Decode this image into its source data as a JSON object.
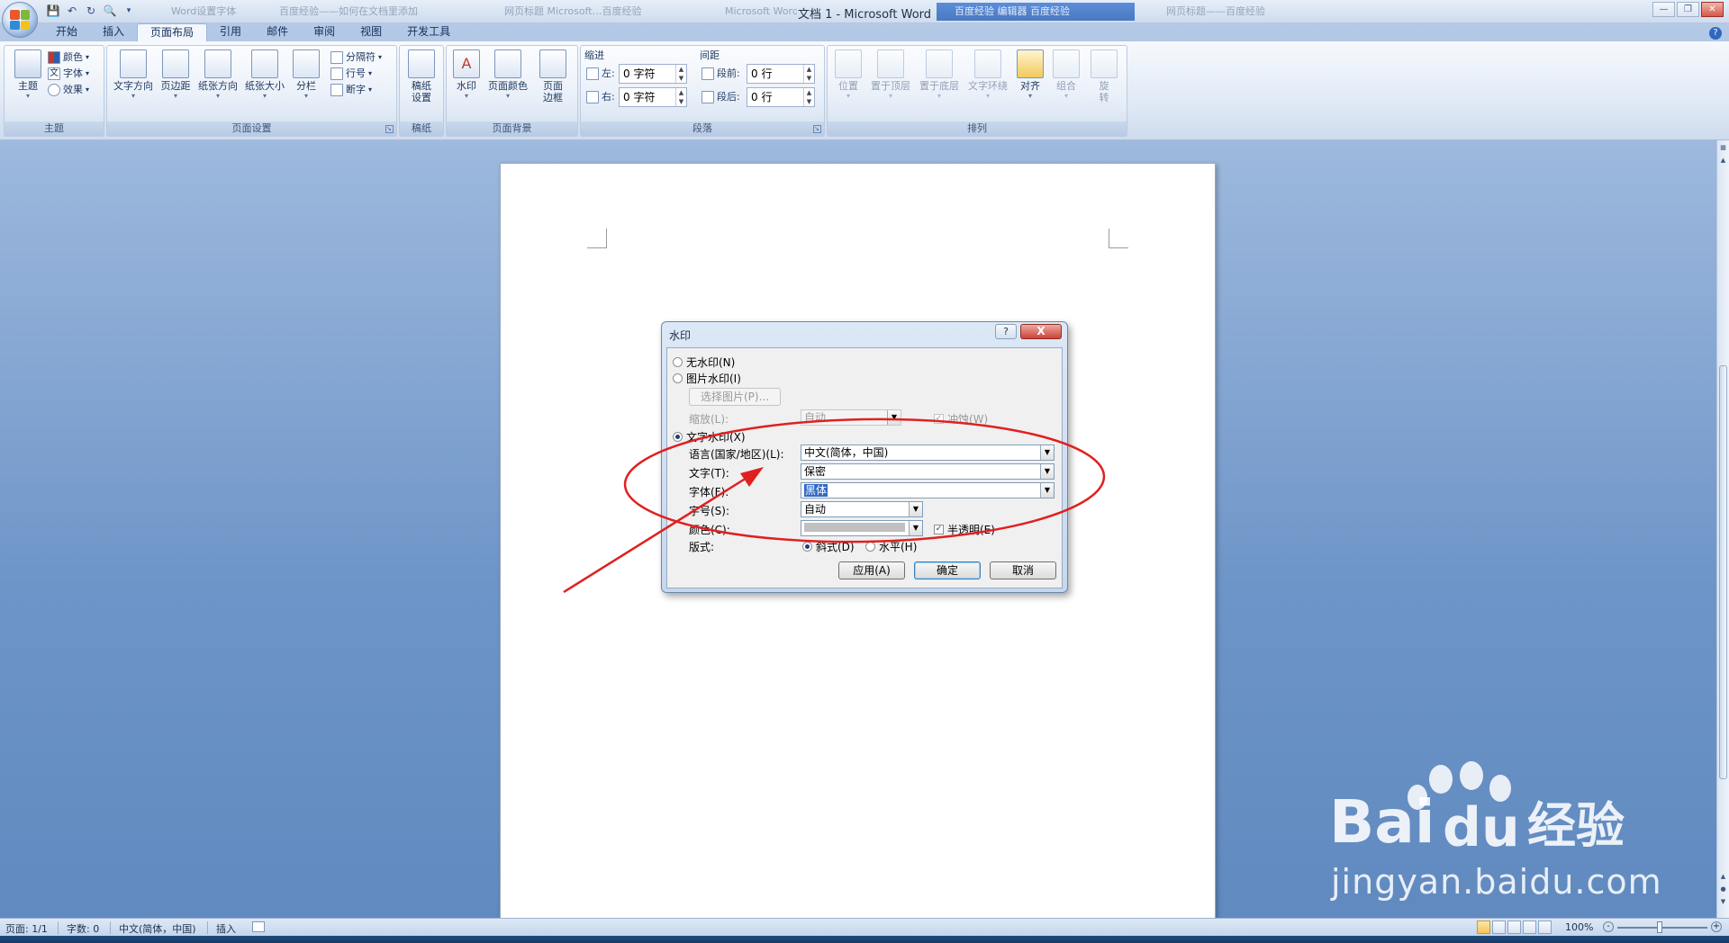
{
  "window": {
    "title": "文档 1 - Microsoft Word",
    "background_tabs": [
      "Word设置字体",
      "百度经验——如何在文档里添加",
      "网页标题 Microsoft…百度经验",
      "Microsoft Word 2007…",
      "百度经验 编辑器 百度经验",
      "网页标题——百度经验"
    ]
  },
  "ribbon": {
    "tabs": [
      "开始",
      "插入",
      "页面布局",
      "引用",
      "邮件",
      "审阅",
      "视图",
      "开发工具"
    ],
    "active_tab": "页面布局",
    "groups": {
      "theme": {
        "label": "主题",
        "main": "主题",
        "colors": "颜色",
        "fonts": "字体",
        "effects": "效果"
      },
      "page_setup": {
        "label": "页面设置",
        "text_direction": "文字方向",
        "margins": "页边距",
        "orientation": "纸张方向",
        "size": "纸张大小",
        "columns": "分栏",
        "breaks": "分隔符",
        "line_numbers": "行号",
        "hyphenation": "断字"
      },
      "draft": {
        "label": "稿纸",
        "draft_settings_1": "稿纸",
        "draft_settings_2": "设置"
      },
      "page_background": {
        "label": "页面背景",
        "watermark": "水印",
        "page_color": "页面颜色",
        "page_borders_1": "页面",
        "page_borders_2": "边框"
      },
      "paragraph": {
        "label": "段落",
        "indent": "缩进",
        "spacing": "间距",
        "left_label": "左:",
        "left_value": "0 字符",
        "right_label": "右:",
        "right_value": "0 字符",
        "before_label": "段前:",
        "before_value": "0 行",
        "after_label": "段后:",
        "after_value": "0 行"
      },
      "arrange": {
        "label": "排列",
        "position": "位置",
        "bring_front": "置于顶层",
        "send_back": "置于底层",
        "text_wrap": "文字环绕",
        "align": "对齐",
        "group": "组合",
        "rotate_1": "旋",
        "rotate_2": "转"
      }
    }
  },
  "dialog": {
    "title": "水印",
    "help": "?",
    "close": "X",
    "no_watermark": "无水印(N)",
    "picture_watermark": "图片水印(I)",
    "select_picture": "选择图片(P)...",
    "scale_label": "缩放(L):",
    "scale_value": "自动",
    "washout": "冲蚀(W)",
    "text_watermark": "文字水印(X)",
    "language_label": "语言(国家/地区)(L):",
    "language_value": "中文(简体，中国)",
    "text_label": "文字(T):",
    "text_value": "保密",
    "font_label": "字体(F):",
    "font_value": "黑体",
    "size_label": "字号(S):",
    "size_value": "自动",
    "color_label": "颜色(C):",
    "semitransparent": "半透明(E)",
    "layout_label": "版式:",
    "diagonal": "斜式(D)",
    "horizontal": "水平(H)",
    "apply": "应用(A)",
    "ok": "确定",
    "cancel": "取消",
    "selected_option": "text_watermark",
    "layout_selected": "diagonal"
  },
  "statusbar": {
    "page": "页面: 1/1",
    "words": "字数: 0",
    "language": "中文(简体，中国)",
    "mode": "插入",
    "zoom": "100%"
  },
  "watermark_overlay": {
    "brand_1": "Bai",
    "brand_2": "du",
    "brand_3": "经验",
    "url": "jingyan.baidu.com"
  },
  "colors": {
    "annotation_red": "#e02020",
    "accent_blue": "#2f68bf"
  }
}
